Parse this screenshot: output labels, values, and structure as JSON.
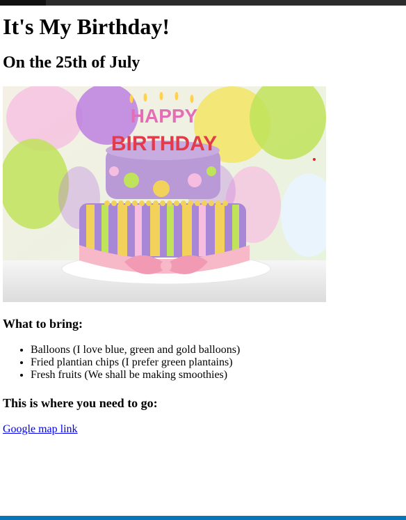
{
  "page": {
    "title": "It's My Birthday!",
    "subtitle": "On the 25th of July"
  },
  "image": {
    "cake_text_line1": "HAPPY",
    "cake_text_line2": "BIRTHDAY",
    "colors": {
      "cake_top": "#b99ad6",
      "cake_bottom_stripe_purple": "#a888d6",
      "cake_bottom_stripe_yellow": "#f2d25a",
      "ribbon": "#f7b8c8",
      "balloon_purple": "#b97ae0",
      "balloon_green": "#bfe35a",
      "balloon_yellow": "#f4e24a",
      "balloon_pink": "#f6bde0"
    }
  },
  "bring": {
    "heading": "What to bring:",
    "items": [
      "Balloons (I love blue, green and gold balloons)",
      "Fried plantian chips (I prefer green plantains)",
      "Fresh fruits (We shall be making smoothies)"
    ]
  },
  "location": {
    "heading": "This is where you need to go:",
    "link_text": "Google map link"
  }
}
